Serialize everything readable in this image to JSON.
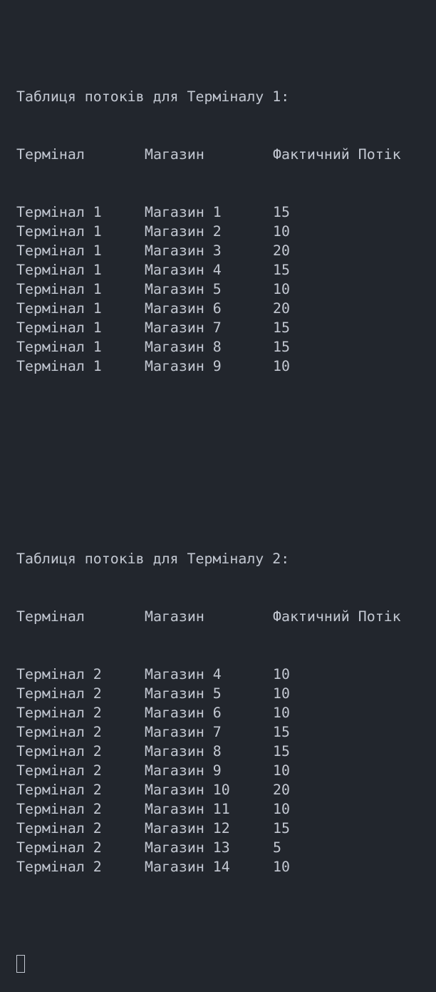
{
  "tables": [
    {
      "title": "Таблиця потоків для Терміналу 1:",
      "headers": [
        "Термінал",
        "Магазин",
        "Фактичний Потік"
      ],
      "rows": [
        [
          "Термінал 1",
          "Магазин 1",
          "15"
        ],
        [
          "Термінал 1",
          "Магазин 2",
          "10"
        ],
        [
          "Термінал 1",
          "Магазин 3",
          "20"
        ],
        [
          "Термінал 1",
          "Магазин 4",
          "15"
        ],
        [
          "Термінал 1",
          "Магазин 5",
          "10"
        ],
        [
          "Термінал 1",
          "Магазин 6",
          "20"
        ],
        [
          "Термінал 1",
          "Магазин 7",
          "15"
        ],
        [
          "Термінал 1",
          "Магазин 8",
          "15"
        ],
        [
          "Термінал 1",
          "Магазин 9",
          "10"
        ]
      ]
    },
    {
      "title": "Таблиця потоків для Терміналу 2:",
      "headers": [
        "Термінал",
        "Магазин",
        "Фактичний Потік"
      ],
      "rows": [
        [
          "Термінал 2",
          "Магазин 4",
          "10"
        ],
        [
          "Термінал 2",
          "Магазин 5",
          "10"
        ],
        [
          "Термінал 2",
          "Магазин 6",
          "10"
        ],
        [
          "Термінал 2",
          "Магазин 7",
          "15"
        ],
        [
          "Термінал 2",
          "Магазин 8",
          "15"
        ],
        [
          "Термінал 2",
          "Магазин 9",
          "10"
        ],
        [
          "Термінал 2",
          "Магазин 10",
          "20"
        ],
        [
          "Термінал 2",
          "Магазин 11",
          "10"
        ],
        [
          "Термінал 2",
          "Магазин 12",
          "15"
        ],
        [
          "Термінал 2",
          "Магазин 13",
          "5"
        ],
        [
          "Термінал 2",
          "Магазин 14",
          "10"
        ]
      ]
    }
  ]
}
